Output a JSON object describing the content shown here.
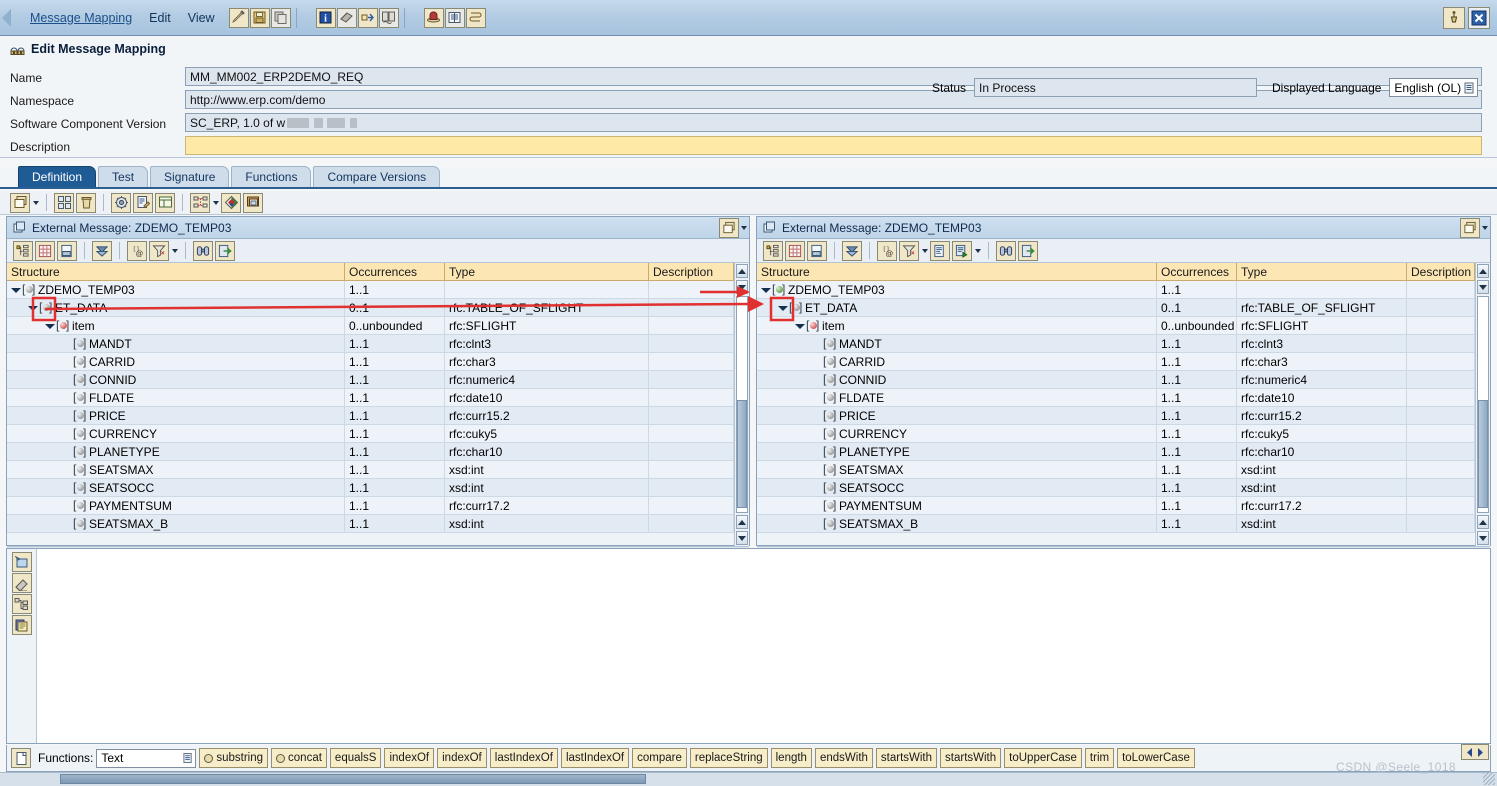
{
  "menubar": {
    "items": [
      {
        "label": "Message Mapping",
        "accel": "M",
        "underline": true
      },
      {
        "label": "Edit",
        "accel": "d",
        "underline": false
      },
      {
        "label": "View",
        "accel": "V",
        "underline": false
      }
    ],
    "buttons": [
      {
        "name": "edit-pencil-icon",
        "title": "Edit"
      },
      {
        "name": "save-icon",
        "title": "Save"
      },
      {
        "name": "copy-icon",
        "title": "Copy"
      },
      {
        "name": "info-icon",
        "title": "Information"
      },
      {
        "name": "book-icon",
        "title": "Documentation"
      },
      {
        "name": "where-used-icon",
        "title": "Where Used"
      },
      {
        "name": "compare-icon",
        "title": "Compare"
      },
      {
        "name": "hat-icon",
        "title": "Expert Mode"
      },
      {
        "name": "list-icon",
        "title": "List"
      },
      {
        "name": "history-icon",
        "title": "History"
      }
    ],
    "window_buttons": [
      {
        "name": "pin-icon",
        "title": "Pin"
      },
      {
        "name": "close-icon",
        "title": "Close"
      }
    ]
  },
  "header": {
    "title": "Edit Message Mapping",
    "fields": [
      {
        "label": "Name",
        "value": "MM_MM002_ERP2DEMO_REQ",
        "type": "text"
      },
      {
        "label": "Namespace",
        "value": "http://www.erp.com/demo",
        "type": "text"
      },
      {
        "label": "Software Component Version",
        "value": "SC_ERP, 1.0 of w",
        "type": "text-redacted"
      },
      {
        "label": "Description",
        "value": "",
        "type": "yellow"
      }
    ],
    "status_label": "Status",
    "status_value": "In Process",
    "language_label": "Displayed Language",
    "language_value": "English (OL)"
  },
  "tabs": [
    {
      "label": "Definition",
      "active": true
    },
    {
      "label": "Test",
      "active": false
    },
    {
      "label": "Signature",
      "active": false
    },
    {
      "label": "Functions",
      "active": false
    },
    {
      "label": "Compare Versions",
      "active": false
    }
  ],
  "main_toolbar": [
    {
      "name": "new-window-icon",
      "dropdown": true
    },
    {
      "name": "sep",
      "dropdown": false
    },
    {
      "name": "dependencies-icon",
      "dropdown": false
    },
    {
      "name": "delete-icon",
      "dropdown": false
    },
    {
      "name": "sep",
      "dropdown": false
    },
    {
      "name": "settings-gear-icon",
      "dropdown": false
    },
    {
      "name": "document-edit-icon",
      "dropdown": false
    },
    {
      "name": "layout-icon",
      "dropdown": false
    },
    {
      "name": "sep",
      "dropdown": false
    },
    {
      "name": "dependency-tree-icon",
      "dropdown": true
    },
    {
      "name": "color-palette-icon",
      "dropdown": false
    },
    {
      "name": "duplicate-window-icon",
      "dropdown": false
    }
  ],
  "panels": {
    "left": {
      "title": "External Message: ZDEMO_TEMP03",
      "toolbar": [
        {
          "name": "tree-view-icon"
        },
        {
          "name": "grid-view-icon"
        },
        {
          "name": "source-view-icon"
        },
        {
          "name": "sep"
        },
        {
          "name": "collapse-icon"
        },
        {
          "name": "sep"
        },
        {
          "name": "context-at-icon"
        },
        {
          "name": "filter-icon",
          "dropdown": true
        },
        {
          "name": "sep"
        },
        {
          "name": "find-binoculars-icon"
        },
        {
          "name": "export-icon"
        }
      ],
      "columns": [
        "Structure",
        "Occurrences",
        "Type",
        "Description"
      ],
      "rows": [
        {
          "indent": 0,
          "twisty": "open",
          "icon": "grey",
          "name": "ZDEMO_TEMP03",
          "occ": "1..1",
          "type": "",
          "desc": ""
        },
        {
          "indent": 1,
          "twisty": "open",
          "icon": "grey",
          "name": "ET_DATA",
          "occ": "0..1",
          "type": "rfc:TABLE_OF_SFLIGHT",
          "desc": ""
        },
        {
          "indent": 2,
          "twisty": "open",
          "icon": "red",
          "name": "item",
          "occ": "0..unbounded",
          "type": "rfc:SFLIGHT",
          "desc": ""
        },
        {
          "indent": 3,
          "twisty": "none",
          "icon": "grey",
          "name": "MANDT",
          "occ": "1..1",
          "type": "rfc:clnt3",
          "desc": ""
        },
        {
          "indent": 3,
          "twisty": "none",
          "icon": "grey",
          "name": "CARRID",
          "occ": "1..1",
          "type": "rfc:char3",
          "desc": ""
        },
        {
          "indent": 3,
          "twisty": "none",
          "icon": "grey",
          "name": "CONNID",
          "occ": "1..1",
          "type": "rfc:numeric4",
          "desc": ""
        },
        {
          "indent": 3,
          "twisty": "none",
          "icon": "grey",
          "name": "FLDATE",
          "occ": "1..1",
          "type": "rfc:date10",
          "desc": ""
        },
        {
          "indent": 3,
          "twisty": "none",
          "icon": "grey",
          "name": "PRICE",
          "occ": "1..1",
          "type": "rfc:curr15.2",
          "desc": ""
        },
        {
          "indent": 3,
          "twisty": "none",
          "icon": "grey",
          "name": "CURRENCY",
          "occ": "1..1",
          "type": "rfc:cuky5",
          "desc": ""
        },
        {
          "indent": 3,
          "twisty": "none",
          "icon": "grey",
          "name": "PLANETYPE",
          "occ": "1..1",
          "type": "rfc:char10",
          "desc": ""
        },
        {
          "indent": 3,
          "twisty": "none",
          "icon": "grey",
          "name": "SEATSMAX",
          "occ": "1..1",
          "type": "xsd:int",
          "desc": ""
        },
        {
          "indent": 3,
          "twisty": "none",
          "icon": "grey",
          "name": "SEATSOCC",
          "occ": "1..1",
          "type": "xsd:int",
          "desc": ""
        },
        {
          "indent": 3,
          "twisty": "none",
          "icon": "grey",
          "name": "PAYMENTSUM",
          "occ": "1..1",
          "type": "rfc:curr17.2",
          "desc": ""
        },
        {
          "indent": 3,
          "twisty": "none",
          "icon": "grey",
          "name": "SEATSMAX_B",
          "occ": "1..1",
          "type": "xsd:int",
          "desc": ""
        }
      ]
    },
    "right": {
      "title": "External Message: ZDEMO_TEMP03",
      "toolbar": [
        {
          "name": "tree-view-icon"
        },
        {
          "name": "grid-view-icon"
        },
        {
          "name": "source-view-icon"
        },
        {
          "name": "sep"
        },
        {
          "name": "collapse-icon"
        },
        {
          "name": "sep"
        },
        {
          "name": "context-at-icon"
        },
        {
          "name": "filter-icon",
          "dropdown": true
        },
        {
          "name": "document-edit-icon"
        },
        {
          "name": "target-field-icon",
          "dropdown": true
        },
        {
          "name": "sep"
        },
        {
          "name": "find-binoculars-icon"
        },
        {
          "name": "export-icon"
        }
      ],
      "columns": [
        "Structure",
        "Occurrences",
        "Type",
        "Description"
      ],
      "rows": [
        {
          "indent": 0,
          "twisty": "open",
          "icon": "green",
          "name": "ZDEMO_TEMP03",
          "occ": "1..1",
          "type": "",
          "desc": ""
        },
        {
          "indent": 1,
          "twisty": "open",
          "icon": "grey",
          "name": "ET_DATA",
          "occ": "0..1",
          "type": "rfc:TABLE_OF_SFLIGHT",
          "desc": ""
        },
        {
          "indent": 2,
          "twisty": "open",
          "icon": "red",
          "name": "item",
          "occ": "0..unbounded",
          "type": "rfc:SFLIGHT",
          "desc": ""
        },
        {
          "indent": 3,
          "twisty": "none",
          "icon": "grey",
          "name": "MANDT",
          "occ": "1..1",
          "type": "rfc:clnt3",
          "desc": ""
        },
        {
          "indent": 3,
          "twisty": "none",
          "icon": "grey",
          "name": "CARRID",
          "occ": "1..1",
          "type": "rfc:char3",
          "desc": ""
        },
        {
          "indent": 3,
          "twisty": "none",
          "icon": "grey",
          "name": "CONNID",
          "occ": "1..1",
          "type": "rfc:numeric4",
          "desc": ""
        },
        {
          "indent": 3,
          "twisty": "none",
          "icon": "grey",
          "name": "FLDATE",
          "occ": "1..1",
          "type": "rfc:date10",
          "desc": ""
        },
        {
          "indent": 3,
          "twisty": "none",
          "icon": "grey",
          "name": "PRICE",
          "occ": "1..1",
          "type": "rfc:curr15.2",
          "desc": ""
        },
        {
          "indent": 3,
          "twisty": "none",
          "icon": "grey",
          "name": "CURRENCY",
          "occ": "1..1",
          "type": "rfc:cuky5",
          "desc": ""
        },
        {
          "indent": 3,
          "twisty": "none",
          "icon": "grey",
          "name": "PLANETYPE",
          "occ": "1..1",
          "type": "rfc:char10",
          "desc": ""
        },
        {
          "indent": 3,
          "twisty": "none",
          "icon": "grey",
          "name": "SEATSMAX",
          "occ": "1..1",
          "type": "xsd:int",
          "desc": ""
        },
        {
          "indent": 3,
          "twisty": "none",
          "icon": "grey",
          "name": "SEATSOCC",
          "occ": "1..1",
          "type": "xsd:int",
          "desc": ""
        },
        {
          "indent": 3,
          "twisty": "none",
          "icon": "grey",
          "name": "PAYMENTSUM",
          "occ": "1..1",
          "type": "rfc:curr17.2",
          "desc": ""
        },
        {
          "indent": 3,
          "twisty": "none",
          "icon": "grey",
          "name": "SEATSMAX_B",
          "occ": "1..1",
          "type": "xsd:int",
          "desc": ""
        }
      ]
    }
  },
  "design_tools": [
    {
      "name": "create-mapping-icon"
    },
    {
      "name": "eraser-icon"
    },
    {
      "name": "structure-icon"
    },
    {
      "name": "clipboard-icon"
    }
  ],
  "functions_bar": {
    "icon": "function-page-icon",
    "label": "Functions:",
    "category": "Text",
    "buttons": [
      {
        "label": "substring",
        "gear": true
      },
      {
        "label": "concat",
        "gear": true
      },
      {
        "label": "equalsS",
        "gear": false
      },
      {
        "label": "indexOf",
        "gear": false
      },
      {
        "label": "indexOf",
        "gear": false
      },
      {
        "label": "lastIndexOf",
        "gear": false
      },
      {
        "label": "lastIndexOf",
        "gear": false
      },
      {
        "label": "compare",
        "gear": false
      },
      {
        "label": "replaceString",
        "gear": false
      },
      {
        "label": "length",
        "gear": false
      },
      {
        "label": "endsWith",
        "gear": false
      },
      {
        "label": "startsWith",
        "gear": false
      },
      {
        "label": "startsWith",
        "gear": false
      },
      {
        "label": "toUpperCase",
        "gear": false
      },
      {
        "label": "trim",
        "gear": false
      },
      {
        "label": "toLowerCase",
        "gear": false
      }
    ]
  },
  "watermark": "CSDN @Seele_1018",
  "colors": {
    "accent": "#1f5c96",
    "header_yellow": "#fbe6b4",
    "arrow_red": "#e03030",
    "field_blue": "#dde6ef",
    "description_yellow": "#ffe9a6"
  }
}
